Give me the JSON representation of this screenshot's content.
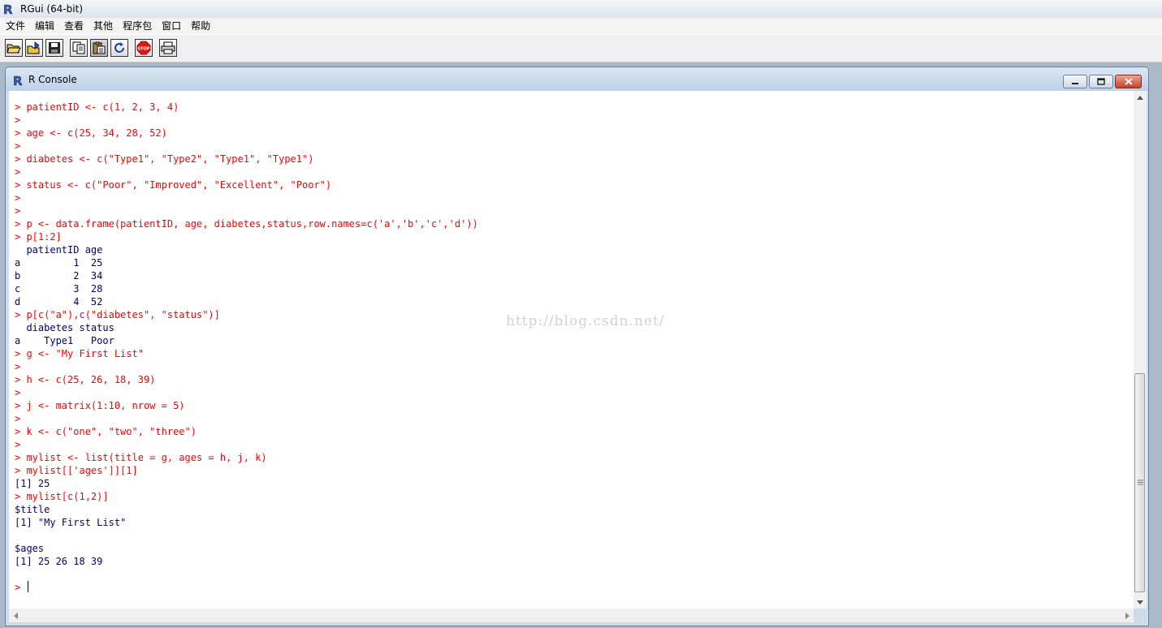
{
  "app": {
    "title": "RGui (64-bit)"
  },
  "menu": [
    "文件",
    "编辑",
    "查看",
    "其他",
    "程序包",
    "窗口",
    "帮助"
  ],
  "toolbar": {
    "buttons": [
      "open-script",
      "load-workspace",
      "save-workspace",
      "copy",
      "paste",
      "copy-paste",
      "stop",
      "print"
    ],
    "stop_label": "STOP"
  },
  "console": {
    "title": "R Console",
    "lines": [
      {
        "type": "input",
        "text": "> patientID <- c(1, 2, 3, 4)"
      },
      {
        "type": "input",
        "text": ">"
      },
      {
        "type": "input",
        "text": "> age <- c(25, 34, 28, 52)"
      },
      {
        "type": "input",
        "text": ">"
      },
      {
        "type": "input",
        "text": "> diabetes <- c(\"Type1\", \"Type2\", \"Type1\", \"Type1\")"
      },
      {
        "type": "input",
        "text": ">"
      },
      {
        "type": "input",
        "text": "> status <- c(\"Poor\", \"Improved\", \"Excellent\", \"Poor\")"
      },
      {
        "type": "input",
        "text": ">"
      },
      {
        "type": "input",
        "text": ">"
      },
      {
        "type": "input",
        "text": "> p <- data.frame(patientID, age, diabetes,status,row.names=c('a','b','c','d'))"
      },
      {
        "type": "input",
        "text": "> p[1:2]"
      },
      {
        "type": "output",
        "text": "  patientID age"
      },
      {
        "type": "output",
        "text": "a         1  25"
      },
      {
        "type": "output",
        "text": "b         2  34"
      },
      {
        "type": "output",
        "text": "c         3  28"
      },
      {
        "type": "output",
        "text": "d         4  52"
      },
      {
        "type": "input",
        "text": "> p[c(\"a\"),c(\"diabetes\", \"status\")]"
      },
      {
        "type": "output",
        "text": "  diabetes status"
      },
      {
        "type": "output",
        "text": "a    Type1   Poor"
      },
      {
        "type": "input",
        "text": "> g <- \"My First List\""
      },
      {
        "type": "input",
        "text": ">"
      },
      {
        "type": "input",
        "text": "> h <- c(25, 26, 18, 39)"
      },
      {
        "type": "input",
        "text": ">"
      },
      {
        "type": "input",
        "text": "> j <- matrix(1:10, nrow = 5)"
      },
      {
        "type": "input",
        "text": ">"
      },
      {
        "type": "input",
        "text": "> k <- c(\"one\", \"two\", \"three\")"
      },
      {
        "type": "input",
        "text": ">"
      },
      {
        "type": "input",
        "text": "> mylist <- list(title = g, ages = h, j, k)"
      },
      {
        "type": "input",
        "text": "> mylist[['ages']][1]"
      },
      {
        "type": "output",
        "text": "[1] 25"
      },
      {
        "type": "input",
        "text": "> mylist[c(1,2)]"
      },
      {
        "type": "output",
        "text": "$title"
      },
      {
        "type": "output",
        "text": "[1] \"My First List\""
      },
      {
        "type": "output",
        "text": ""
      },
      {
        "type": "output",
        "text": "$ages"
      },
      {
        "type": "output",
        "text": "[1] 25 26 18 39"
      },
      {
        "type": "output",
        "text": ""
      },
      {
        "type": "input",
        "text": "> ",
        "cursor": true
      }
    ]
  },
  "watermark": "http://blog.csdn.net/",
  "colors": {
    "input": "#ff0000",
    "output": "#000080",
    "accent": "#3b5ba8"
  }
}
